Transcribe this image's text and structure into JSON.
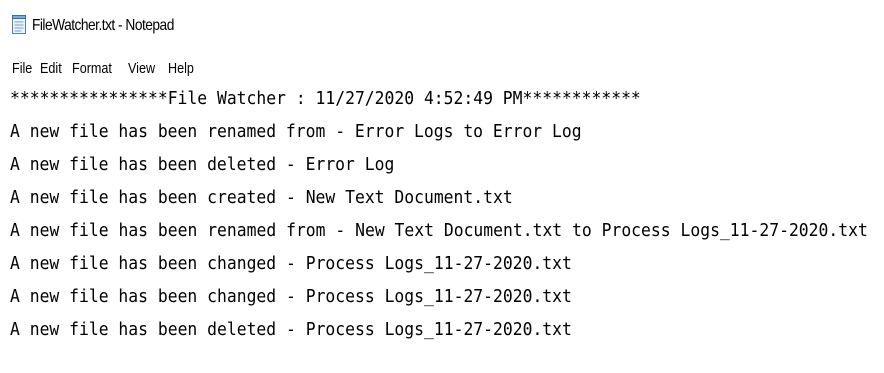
{
  "window": {
    "title": "FileWatcher.txt - Notepad",
    "icon": "notepad-icon"
  },
  "menu": {
    "items": [
      "File",
      "Edit",
      "Format",
      "View",
      "Help"
    ]
  },
  "document": {
    "lines": [
      "****************File Watcher : 11/27/2020 4:52:49 PM************",
      "A new file has been renamed from - Error Logs to Error Log",
      "A new file has been deleted - Error Log",
      "A new file has been created - New Text Document.txt",
      "A new file has been renamed from - New Text Document.txt to Process Logs_11-27-2020.txt",
      "A new file has been changed - Process Logs_11-27-2020.txt",
      "A new file has been changed - Process Logs_11-27-2020.txt",
      "A new file has been deleted - Process Logs_11-27-2020.txt"
    ]
  }
}
